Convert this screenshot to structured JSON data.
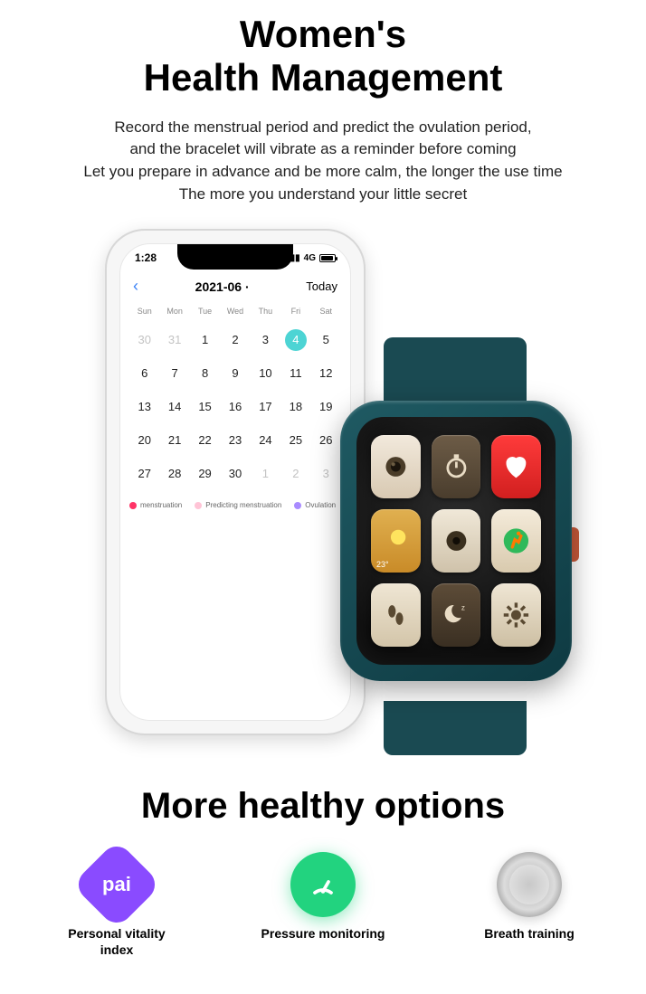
{
  "title_line1": "Women's",
  "title_line2": "Health Management",
  "subtitle": "Record the menstrual period and predict the ovulation period,\nand the bracelet  will vibrate as a reminder before coming\nLet you prepare in advance and be more calm, the longer the use time\nThe more you understand your little secret",
  "phone": {
    "status_time": "1:28",
    "status_net": "4G",
    "back_icon": "‹",
    "month_label": "2021-06 ·",
    "today_label": "Today",
    "day_headers": [
      "Sun",
      "Mon",
      "Tue",
      "Wed",
      "Thu",
      "Fri",
      "Sat"
    ],
    "rows": [
      [
        {
          "v": "30",
          "muted": true
        },
        {
          "v": "31",
          "muted": true
        },
        {
          "v": "1"
        },
        {
          "v": "2"
        },
        {
          "v": "3"
        },
        {
          "v": "4",
          "highlight": true
        },
        {
          "v": "5"
        }
      ],
      [
        {
          "v": "6"
        },
        {
          "v": "7"
        },
        {
          "v": "8"
        },
        {
          "v": "9"
        },
        {
          "v": "10"
        },
        {
          "v": "11"
        },
        {
          "v": "12"
        }
      ],
      [
        {
          "v": "13"
        },
        {
          "v": "14"
        },
        {
          "v": "15"
        },
        {
          "v": "16"
        },
        {
          "v": "17"
        },
        {
          "v": "18"
        },
        {
          "v": "19"
        }
      ],
      [
        {
          "v": "20"
        },
        {
          "v": "21"
        },
        {
          "v": "22"
        },
        {
          "v": "23"
        },
        {
          "v": "24"
        },
        {
          "v": "25"
        },
        {
          "v": "26"
        }
      ],
      [
        {
          "v": "27"
        },
        {
          "v": "28"
        },
        {
          "v": "29"
        },
        {
          "v": "30"
        },
        {
          "v": "1",
          "muted": true
        },
        {
          "v": "2",
          "muted": true
        },
        {
          "v": "3",
          "muted": true
        }
      ]
    ],
    "legend": {
      "menstruation": "menstruation",
      "predicting": "Predicting menstruation",
      "ovulation": "Ovulation"
    }
  },
  "watch": {
    "weather_temp": "23°",
    "apps": [
      "camera",
      "stopwatch",
      "heart",
      "weather",
      "dial",
      "run",
      "steps",
      "sleep",
      "settings"
    ]
  },
  "more_title": "More healthy options",
  "options": {
    "pai": {
      "icon_text": "pai",
      "label": "Personal vitality\nindex"
    },
    "pressure": {
      "label": "Pressure monitoring"
    },
    "breath": {
      "label": "Breath training"
    }
  }
}
